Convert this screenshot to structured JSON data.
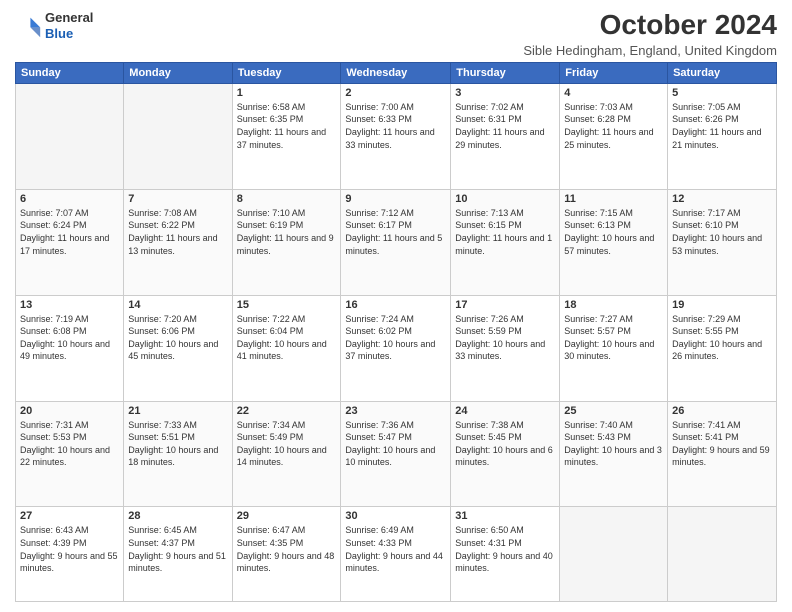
{
  "header": {
    "logo": {
      "general": "General",
      "blue": "Blue"
    },
    "title": "October 2024",
    "subtitle": "Sible Hedingham, England, United Kingdom"
  },
  "days_of_week": [
    "Sunday",
    "Monday",
    "Tuesday",
    "Wednesday",
    "Thursday",
    "Friday",
    "Saturday"
  ],
  "weeks": [
    [
      {
        "day": "",
        "empty": true
      },
      {
        "day": "",
        "empty": true
      },
      {
        "day": "1",
        "sunrise": "6:58 AM",
        "sunset": "6:35 PM",
        "daylight": "11 hours and 37 minutes."
      },
      {
        "day": "2",
        "sunrise": "7:00 AM",
        "sunset": "6:33 PM",
        "daylight": "11 hours and 33 minutes."
      },
      {
        "day": "3",
        "sunrise": "7:02 AM",
        "sunset": "6:31 PM",
        "daylight": "11 hours and 29 minutes."
      },
      {
        "day": "4",
        "sunrise": "7:03 AM",
        "sunset": "6:28 PM",
        "daylight": "11 hours and 25 minutes."
      },
      {
        "day": "5",
        "sunrise": "7:05 AM",
        "sunset": "6:26 PM",
        "daylight": "11 hours and 21 minutes."
      }
    ],
    [
      {
        "day": "6",
        "sunrise": "7:07 AM",
        "sunset": "6:24 PM",
        "daylight": "11 hours and 17 minutes."
      },
      {
        "day": "7",
        "sunrise": "7:08 AM",
        "sunset": "6:22 PM",
        "daylight": "11 hours and 13 minutes."
      },
      {
        "day": "8",
        "sunrise": "7:10 AM",
        "sunset": "6:19 PM",
        "daylight": "11 hours and 9 minutes."
      },
      {
        "day": "9",
        "sunrise": "7:12 AM",
        "sunset": "6:17 PM",
        "daylight": "11 hours and 5 minutes."
      },
      {
        "day": "10",
        "sunrise": "7:13 AM",
        "sunset": "6:15 PM",
        "daylight": "11 hours and 1 minute."
      },
      {
        "day": "11",
        "sunrise": "7:15 AM",
        "sunset": "6:13 PM",
        "daylight": "10 hours and 57 minutes."
      },
      {
        "day": "12",
        "sunrise": "7:17 AM",
        "sunset": "6:10 PM",
        "daylight": "10 hours and 53 minutes."
      }
    ],
    [
      {
        "day": "13",
        "sunrise": "7:19 AM",
        "sunset": "6:08 PM",
        "daylight": "10 hours and 49 minutes."
      },
      {
        "day": "14",
        "sunrise": "7:20 AM",
        "sunset": "6:06 PM",
        "daylight": "10 hours and 45 minutes."
      },
      {
        "day": "15",
        "sunrise": "7:22 AM",
        "sunset": "6:04 PM",
        "daylight": "10 hours and 41 minutes."
      },
      {
        "day": "16",
        "sunrise": "7:24 AM",
        "sunset": "6:02 PM",
        "daylight": "10 hours and 37 minutes."
      },
      {
        "day": "17",
        "sunrise": "7:26 AM",
        "sunset": "5:59 PM",
        "daylight": "10 hours and 33 minutes."
      },
      {
        "day": "18",
        "sunrise": "7:27 AM",
        "sunset": "5:57 PM",
        "daylight": "10 hours and 30 minutes."
      },
      {
        "day": "19",
        "sunrise": "7:29 AM",
        "sunset": "5:55 PM",
        "daylight": "10 hours and 26 minutes."
      }
    ],
    [
      {
        "day": "20",
        "sunrise": "7:31 AM",
        "sunset": "5:53 PM",
        "daylight": "10 hours and 22 minutes."
      },
      {
        "day": "21",
        "sunrise": "7:33 AM",
        "sunset": "5:51 PM",
        "daylight": "10 hours and 18 minutes."
      },
      {
        "day": "22",
        "sunrise": "7:34 AM",
        "sunset": "5:49 PM",
        "daylight": "10 hours and 14 minutes."
      },
      {
        "day": "23",
        "sunrise": "7:36 AM",
        "sunset": "5:47 PM",
        "daylight": "10 hours and 10 minutes."
      },
      {
        "day": "24",
        "sunrise": "7:38 AM",
        "sunset": "5:45 PM",
        "daylight": "10 hours and 6 minutes."
      },
      {
        "day": "25",
        "sunrise": "7:40 AM",
        "sunset": "5:43 PM",
        "daylight": "10 hours and 3 minutes."
      },
      {
        "day": "26",
        "sunrise": "7:41 AM",
        "sunset": "5:41 PM",
        "daylight": "9 hours and 59 minutes."
      }
    ],
    [
      {
        "day": "27",
        "sunrise": "6:43 AM",
        "sunset": "4:39 PM",
        "daylight": "9 hours and 55 minutes."
      },
      {
        "day": "28",
        "sunrise": "6:45 AM",
        "sunset": "4:37 PM",
        "daylight": "9 hours and 51 minutes."
      },
      {
        "day": "29",
        "sunrise": "6:47 AM",
        "sunset": "4:35 PM",
        "daylight": "9 hours and 48 minutes."
      },
      {
        "day": "30",
        "sunrise": "6:49 AM",
        "sunset": "4:33 PM",
        "daylight": "9 hours and 44 minutes."
      },
      {
        "day": "31",
        "sunrise": "6:50 AM",
        "sunset": "4:31 PM",
        "daylight": "9 hours and 40 minutes."
      },
      {
        "day": "",
        "empty": true
      },
      {
        "day": "",
        "empty": true
      }
    ]
  ]
}
